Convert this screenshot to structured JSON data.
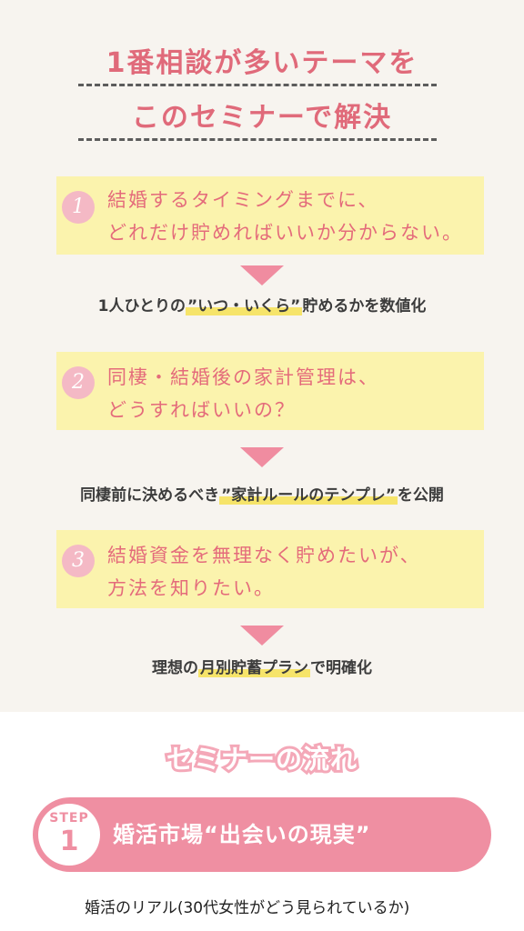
{
  "header": {
    "title_line1": "1番相談が多いテーマを",
    "title_line2": "このセミナーで解決"
  },
  "problems": [
    {
      "number": "1",
      "line1": "結婚するタイミングまでに、",
      "line2": "どれだけ貯めればいいか分からない。",
      "answer_pre": "1人ひとりの",
      "answer_hl": "”いつ・いくら”",
      "answer_post": "貯めるかを数値化"
    },
    {
      "number": "2",
      "line1": "同棲・結婚後の家計管理は、",
      "line2": "どうすればいいの？",
      "answer_pre": "同棲前に決めるべき",
      "answer_hl": "”家計ルールのテンプレ”",
      "answer_post": "を公開"
    },
    {
      "number": "3",
      "line1": "結婚資金を無理なく貯めたいが、",
      "line2": "方法を知りたい。",
      "answer_pre": "理想の",
      "answer_hl": "月別貯蓄プラン",
      "answer_post": "で明確化"
    }
  ],
  "flow": {
    "title": "セミナーの流れ",
    "step_word": "STEP",
    "step_number": "1",
    "step_title": "婚活市場“出会いの現実”",
    "step_desc": "婚活のリアル(30代女性がどう見られているか)"
  },
  "colors": {
    "title_pink": "#e06a7a",
    "problem_bg": "#fbf3ad",
    "arrow": "#f08ca0",
    "highlight": "#f6e46a",
    "step_bar": "#ef8fa2"
  }
}
